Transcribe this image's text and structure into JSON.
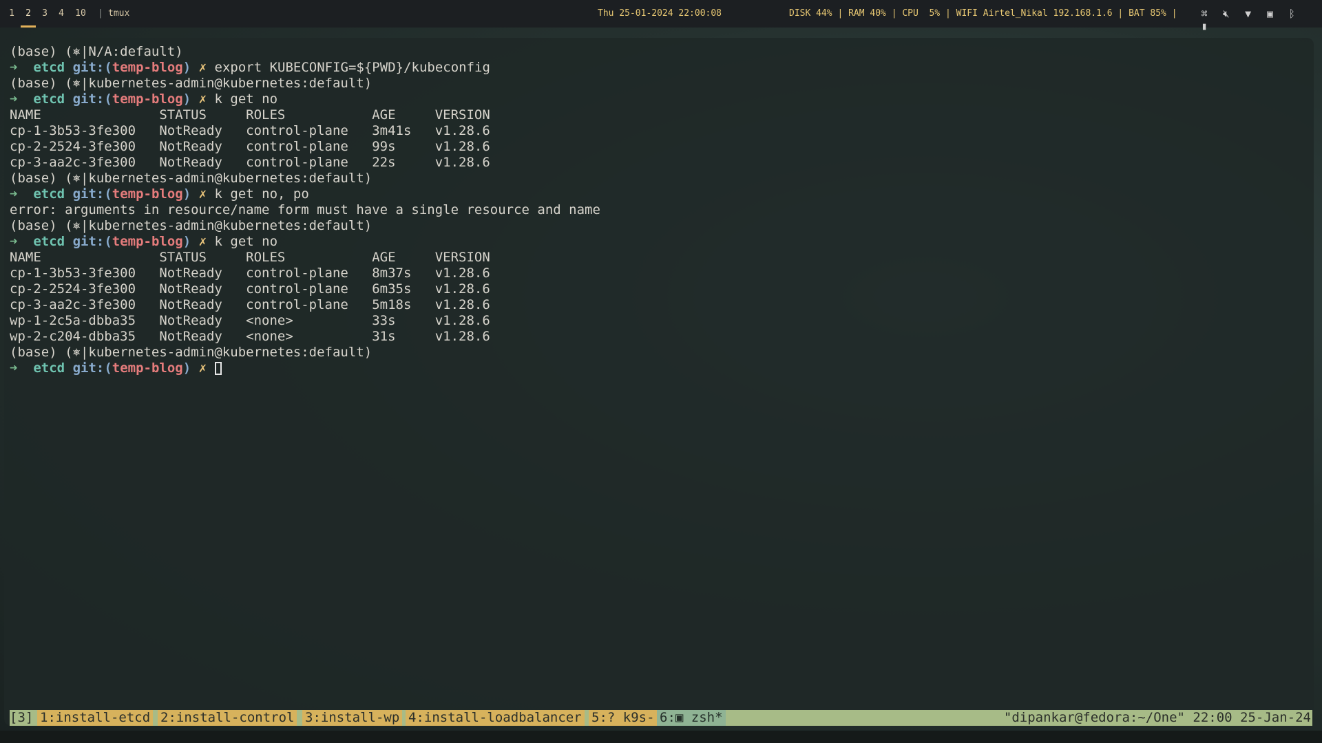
{
  "topbar": {
    "workspaces": [
      {
        "label": "1",
        "active": false
      },
      {
        "label": "2",
        "active": true
      },
      {
        "label": "3",
        "active": false
      },
      {
        "label": "4",
        "active": false
      },
      {
        "label": "10",
        "active": false
      }
    ],
    "separator": "|",
    "app": "tmux",
    "clock": "Thu 25-01-2024 22:00:08",
    "stats": "DISK 44% | RAM 40% | CPU  5% | WIFI Airtel_Nikal 192.168.1.6 | BAT 85% |",
    "tray_icons": [
      "network-icon",
      "mute-icon",
      "wifi-icon",
      "display-icon",
      "bluetooth-icon",
      "battery-icon"
    ]
  },
  "terminal": {
    "lines": [
      {
        "type": "ctx",
        "text": "(base) (⎈|N/A:default)"
      },
      {
        "type": "prompt",
        "dir": "etcd",
        "branch": "temp-blog",
        "cmd": "export KUBECONFIG=${PWD}/kubeconfig"
      },
      {
        "type": "ctx",
        "text": "(base) (⎈|kubernetes-admin@kubernetes:default)"
      },
      {
        "type": "prompt",
        "dir": "etcd",
        "branch": "temp-blog",
        "cmd": "k get no"
      },
      {
        "type": "out",
        "text": "NAME               STATUS     ROLES           AGE     VERSION"
      },
      {
        "type": "out",
        "text": "cp-1-3b53-3fe300   NotReady   control-plane   3m41s   v1.28.6"
      },
      {
        "type": "out",
        "text": "cp-2-2524-3fe300   NotReady   control-plane   99s     v1.28.6"
      },
      {
        "type": "out",
        "text": "cp-3-aa2c-3fe300   NotReady   control-plane   22s     v1.28.6"
      },
      {
        "type": "ctx",
        "text": "(base) (⎈|kubernetes-admin@kubernetes:default)"
      },
      {
        "type": "prompt",
        "dir": "etcd",
        "branch": "temp-blog",
        "cmd": "k get no, po"
      },
      {
        "type": "out",
        "text": "error: arguments in resource/name form must have a single resource and name"
      },
      {
        "type": "ctx",
        "text": "(base) (⎈|kubernetes-admin@kubernetes:default)"
      },
      {
        "type": "prompt",
        "dir": "etcd",
        "branch": "temp-blog",
        "cmd": "k get no"
      },
      {
        "type": "out",
        "text": "NAME               STATUS     ROLES           AGE     VERSION"
      },
      {
        "type": "out",
        "text": "cp-1-3b53-3fe300   NotReady   control-plane   8m37s   v1.28.6"
      },
      {
        "type": "out",
        "text": "cp-2-2524-3fe300   NotReady   control-plane   6m35s   v1.28.6"
      },
      {
        "type": "out",
        "text": "cp-3-aa2c-3fe300   NotReady   control-plane   5m18s   v1.28.6"
      },
      {
        "type": "out",
        "text": "wp-1-2c5a-dbba35   NotReady   <none>          33s     v1.28.6"
      },
      {
        "type": "out",
        "text": "wp-2-c204-dbba35   NotReady   <none>          31s     v1.28.6"
      },
      {
        "type": "ctx",
        "text": "(base) (⎈|kubernetes-admin@kubernetes:default)"
      },
      {
        "type": "prompt",
        "dir": "etcd",
        "branch": "temp-blog",
        "cmd": "",
        "cursor": true
      }
    ]
  },
  "tmux": {
    "session": "[3]",
    "windows": [
      {
        "label": "1:install-etcd",
        "active": false
      },
      {
        "label": "2:install-control",
        "active": false
      },
      {
        "label": "3:install-wp",
        "active": false
      },
      {
        "label": "4:install-loadbalancer",
        "active": false
      },
      {
        "label": "5:? k9s-",
        "active": false
      },
      {
        "label": "6:▣ zsh*",
        "active": true
      }
    ],
    "status_right": "\"dipankar@fedora:~/One\" 22:00 25-Jan-24"
  },
  "colors": {
    "topbar_bg": "#1c1f22",
    "accent": "#e3b15a",
    "terminal_bg": "#1f2827",
    "tmux_bar": "#a7bb87",
    "tmux_window": "#d7b25c",
    "tmux_active": "#8fb394"
  }
}
